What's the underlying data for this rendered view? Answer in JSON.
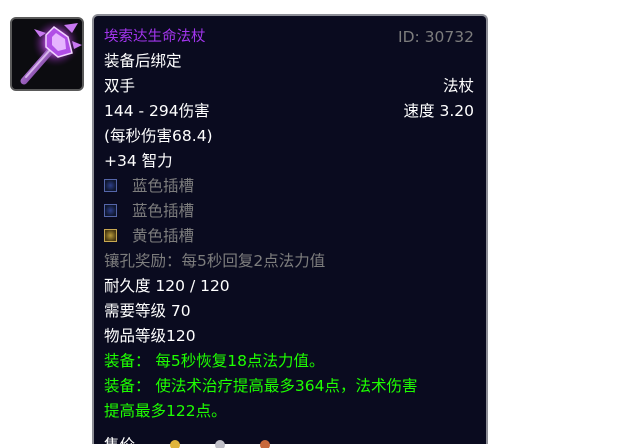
{
  "item": {
    "icon": "wand-staff-icon",
    "name": "埃索达生命法杖",
    "id_label": "ID: 30732",
    "bind": "装备后绑定",
    "hand": "双手",
    "type": "法杖",
    "damage": "144 - 294伤害",
    "speed": "速度 3.20",
    "dps": "(每秒伤害68.4)",
    "stat": "+34 智力",
    "sockets": [
      {
        "color": "blue",
        "label": "蓝色插槽"
      },
      {
        "color": "blue",
        "label": "蓝色插槽"
      },
      {
        "color": "yellow",
        "label": "黄色插槽"
      }
    ],
    "socket_bonus": "镶孔奖励：每5秒回复2点法力值",
    "durability": "耐久度 120 / 120",
    "required_level": "需要等级 70",
    "item_level": "物品等级120",
    "equip_1": "装备： 每5秒恢复18点法力值。",
    "equip_2a": "装备： 使法术治疗提高最多364点，法术伤害",
    "equip_2b": "提高最多122点。",
    "sell_label": "售价"
  },
  "colors": {
    "epic": "#a335ee",
    "equip": "#1eff00",
    "disabled": "#7d7d7d",
    "tooltip_bg": "#0a0b1f",
    "tooltip_border": "#8d8e96"
  }
}
